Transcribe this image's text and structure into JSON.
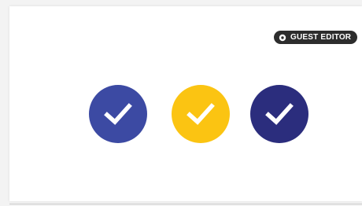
{
  "badge": {
    "label": "GUEST EDITOR",
    "icon": "gear-icon"
  },
  "checks": [
    {
      "name": "check-circle-blue",
      "color": "#3c4aa3"
    },
    {
      "name": "check-circle-yellow",
      "color": "#fbc412"
    },
    {
      "name": "check-circle-navy",
      "color": "#2b2d7d"
    }
  ],
  "colors": {
    "background": "#f3f3f3",
    "card": "#ffffff",
    "badge": "#2d2d2d",
    "check_mark": "#ffffff"
  }
}
